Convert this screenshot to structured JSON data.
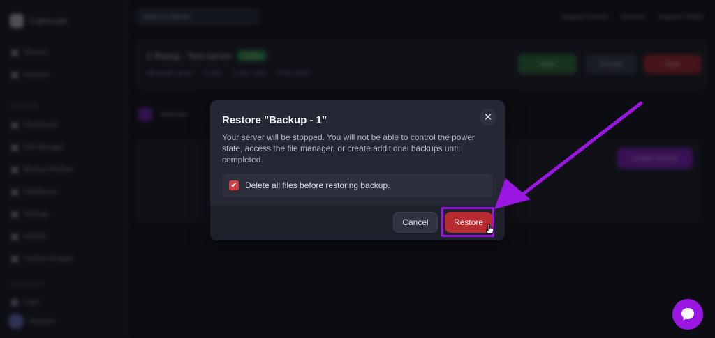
{
  "background": {
    "brand": "Calmnode",
    "sidebar_items_top": [
      "Servers",
      "Account"
    ],
    "sidebar_section_1": "SERVER",
    "sidebar_items_server": [
      "Dashboard",
      "File Manager",
      "Backup Restore",
      "Databases",
      "Settings",
      "Activity",
      "Custom Images"
    ],
    "sidebar_section_2": "ACCOUNT",
    "sidebar_items_account": [
      "Logs"
    ],
    "user_name": "Account",
    "server_select": "Select a Server",
    "top_links": [
      "Support Center",
      "Discord",
      "Support Ticket"
    ],
    "server_name": "1 Rising - Test server",
    "server_status": "Online",
    "server_meta": [
      "Minecraft Server",
      "0.00%",
      "0 MB / 1GB",
      "0 MB / 8GB"
    ],
    "start_label": "Start",
    "restart_label": "Restart",
    "stop_label": "Stop",
    "tab_label": "Backups",
    "create_backup_label": "Create backup"
  },
  "modal": {
    "title": "Restore \"Backup - 1\"",
    "close_glyph": "✕",
    "body": "Your server will be stopped. You will not be able to control the power state, access the file manager, or create additional backups until completed.",
    "checkbox_label": "Delete all files before restoring backup.",
    "checkbox_checked": true,
    "checkbox_glyph": "✔",
    "cancel_label": "Cancel",
    "restore_label": "Restore"
  },
  "colors": {
    "accent_purple": "#9b16e0",
    "danger_red": "#b72b31",
    "checkbox_red": "#d23b46"
  },
  "icons": {
    "close": "close-icon",
    "check": "check-icon",
    "chat": "chat-bubble-icon",
    "arrow": "annotation-arrow-icon",
    "cursor": "hand-pointer-icon"
  }
}
